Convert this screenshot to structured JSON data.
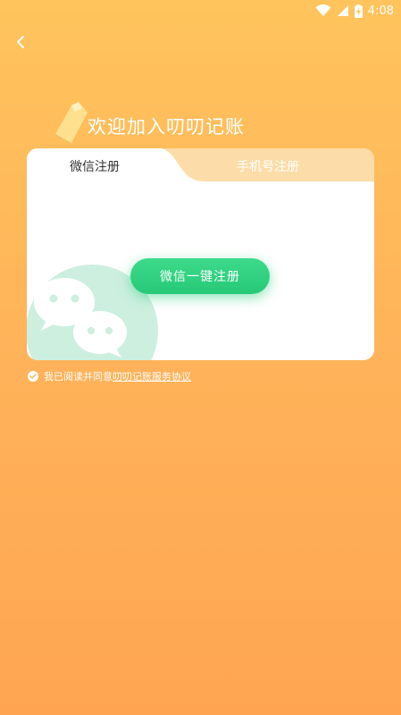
{
  "status_bar": {
    "time": "4:08"
  },
  "title": "欢迎加入叨叨记账",
  "tabs": [
    {
      "label": "微信注册",
      "active": true
    },
    {
      "label": "手机号注册",
      "active": false
    }
  ],
  "primary_button": "微信一键注册",
  "agreement": {
    "prefix": "我已阅读并同意",
    "link": "叨叨记账服务协议",
    "checked": true
  },
  "colors": {
    "background_top": "#FFC45C",
    "background_bottom": "#FFA552",
    "accent_green": "#2DD17C",
    "mint": "#CDEFE0",
    "tab_inactive": "#FCDCA8"
  },
  "icons": [
    "wifi-icon",
    "signal-icon",
    "battery-charging-icon",
    "back-arrow-icon",
    "wechat-logo-icon",
    "check-circle-icon"
  ]
}
